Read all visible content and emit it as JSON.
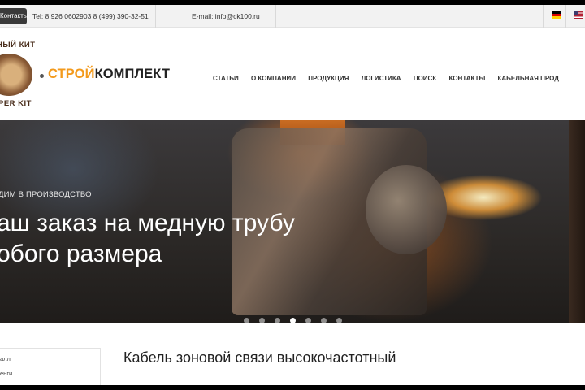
{
  "topbar": {
    "contacts_label": "Контакты",
    "phone": "Tel: 8 926 0602903 8 (499) 390-32-51",
    "email": "E-mail: info@ck100.ru",
    "languages": [
      "de",
      "en"
    ]
  },
  "logo": {
    "arc_top": "НЫЙ КИТ",
    "arc_bottom": "PER KIT",
    "brand_part1": "СТРОЙ",
    "brand_part2": "КОМПЛЕКТ",
    "brand_accent_color": "#f39a1c"
  },
  "nav": {
    "items": [
      "СТАТЬИ",
      "О КОМПАНИИ",
      "ПРОДУКЦИЯ",
      "ЛОГИСТИКА",
      "ПОИСК",
      "КОНТАКТЫ",
      "КАБЕЛЬНАЯ ПРОД"
    ]
  },
  "hero": {
    "kicker": "ДИМ В ПРОИЗВОДСТВО",
    "title_line1": "аш заказ на медную трубу",
    "title_line2": "обого размера",
    "slides": 7,
    "active_slide": 4
  },
  "sidebar": {
    "items": [
      "алл",
      "енги"
    ]
  },
  "content": {
    "title": "Кабель зоновой связи высокочастотный"
  }
}
